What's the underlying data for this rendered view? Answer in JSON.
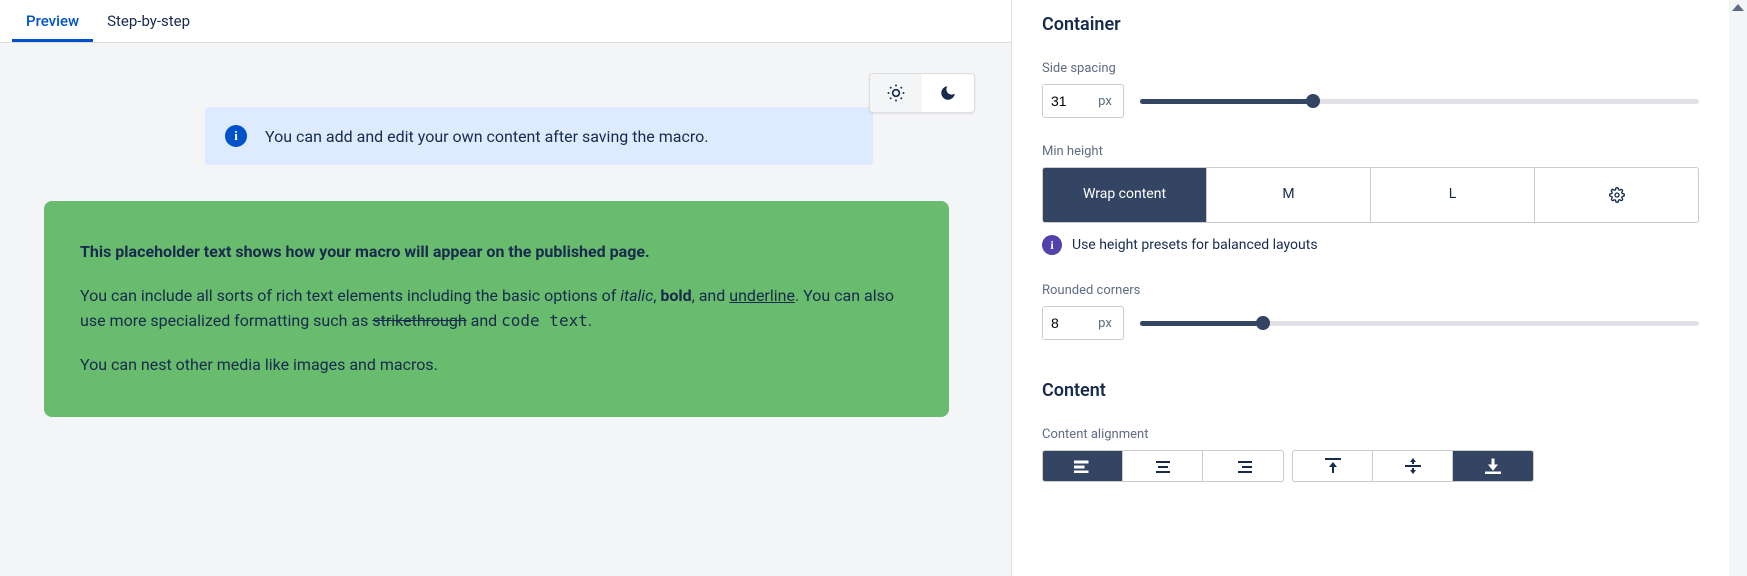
{
  "tabs": {
    "preview": "Preview",
    "step_by_step": "Step-by-step"
  },
  "theme": {
    "light": "sun-icon",
    "dark": "moon-icon"
  },
  "banner": {
    "text": "You can add and edit your own content after saving the macro."
  },
  "placeholder": {
    "lead": "This placeholder text shows how your macro will appear on the published page.",
    "p1_a": "You can include all sorts of rich text elements including the basic options of ",
    "p1_italic": "italic",
    "p1_sep1": ", ",
    "p1_bold": "bold",
    "p1_sep2": ", and ",
    "p1_underline": "underline",
    "p1_b": ". You can also use more specialized formatting such as ",
    "p1_strike": "strikethrough",
    "p1_c": " and ",
    "p1_code": "code text",
    "p1_d": ".",
    "p2": "You can nest other media like images and macros."
  },
  "sidebar": {
    "container_title": "Container",
    "side_spacing_label": "Side spacing",
    "side_spacing_value": "31",
    "side_spacing_unit": "px",
    "side_spacing_percent": 31,
    "min_height_label": "Min height",
    "min_height_options": {
      "wrap": "Wrap content",
      "m": "M",
      "l": "L",
      "gear": "gear-icon"
    },
    "min_height_hint": "Use height presets for balanced layouts",
    "rounded_label": "Rounded corners",
    "rounded_value": "8",
    "rounded_unit": "px",
    "rounded_percent": 22,
    "content_title": "Content",
    "alignment_label": "Content alignment"
  }
}
